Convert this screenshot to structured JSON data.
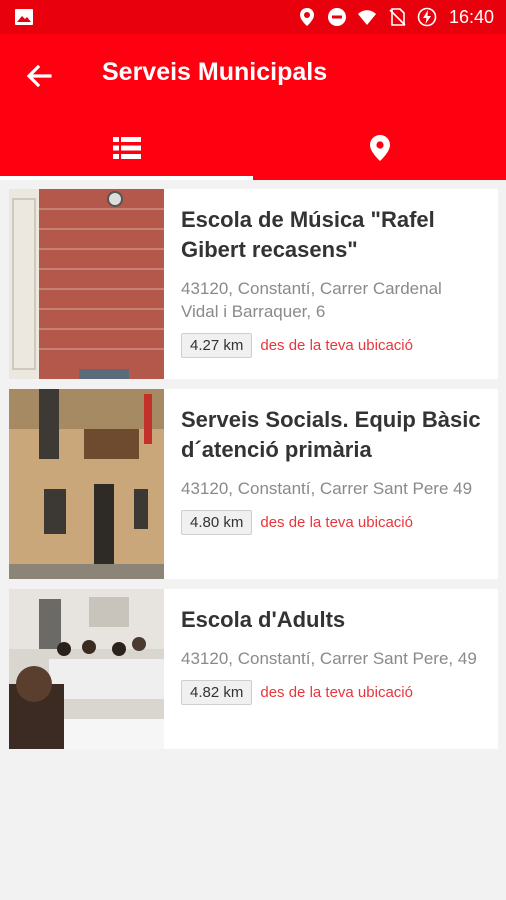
{
  "status_bar": {
    "time": "16:40",
    "icons": [
      "image-icon",
      "location-icon",
      "do-not-disturb-icon",
      "wifi-icon",
      "no-sim-icon",
      "battery-charging-icon"
    ]
  },
  "app_bar": {
    "title": "Serveis Municipals",
    "back_icon": "arrow-back-icon"
  },
  "tabs": [
    {
      "icon": "list-icon",
      "active": true
    },
    {
      "icon": "map-marker-icon",
      "active": false
    }
  ],
  "items": [
    {
      "name": "Escola de Música \"Rafel Gibert recasens\"",
      "address": "43120, Constantí, Carrer Cardenal Vidal i Barraquer, 6",
      "distance": "4.27 km",
      "distance_suffix": "des de la teva ubicació"
    },
    {
      "name": "Serveis Socials. Equip Bàsic d´atenció primària",
      "address": "43120, Constantí, Carrer Sant Pere 49",
      "distance": "4.80 km",
      "distance_suffix": "des de la teva ubicació"
    },
    {
      "name": "Escola d'Adults",
      "address": "43120, Constantí, Carrer Sant Pere, 49",
      "distance": "4.82 km",
      "distance_suffix": "des de la teva ubicació"
    }
  ],
  "colors": {
    "primary": "#ff0010",
    "status_bar": "#e8000d",
    "accent_text": "#e8363c"
  }
}
